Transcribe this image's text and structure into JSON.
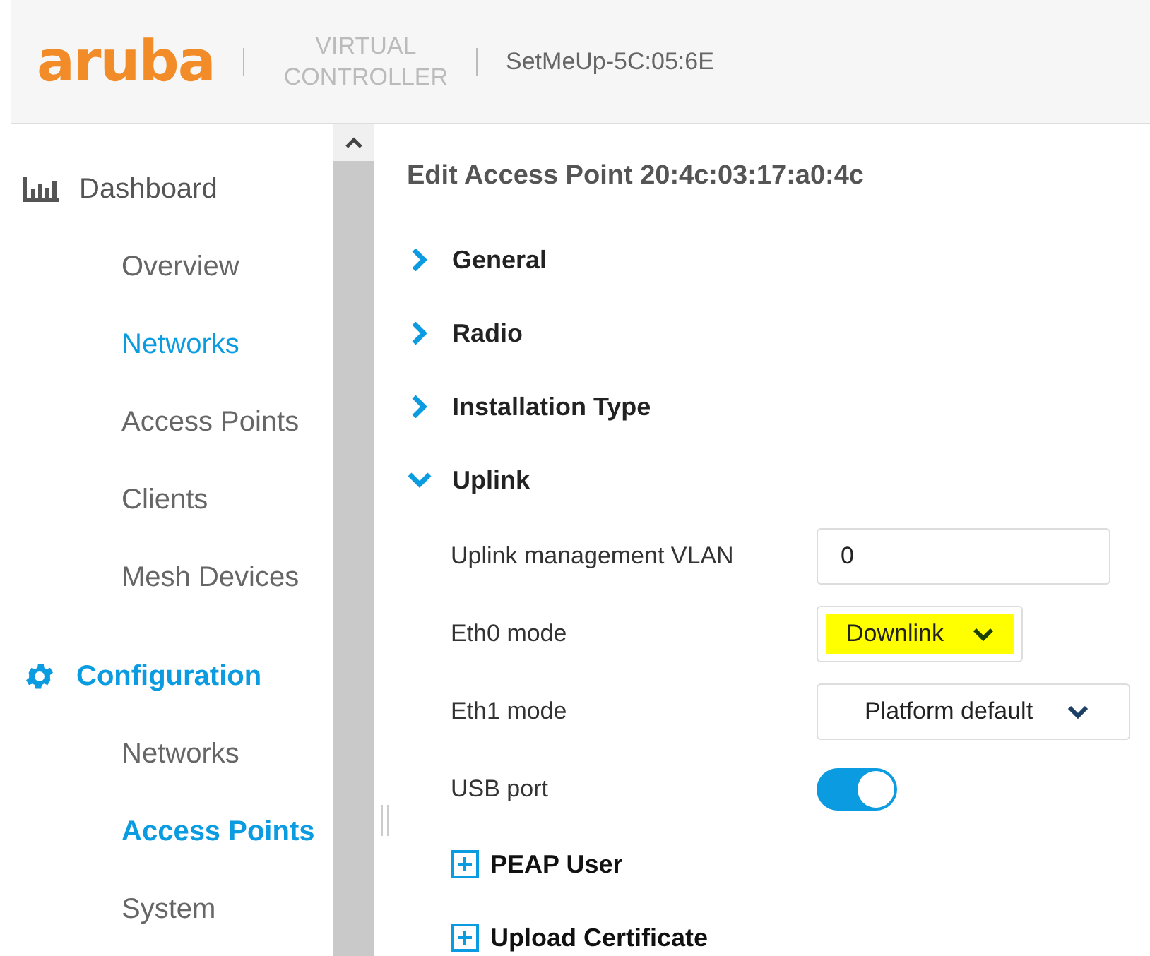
{
  "header": {
    "logo": "aruba",
    "product": [
      "VIRTUAL",
      "CONTROLLER"
    ],
    "device_name": "SetMeUp-5C:05:6E"
  },
  "sidebar": {
    "sections": [
      {
        "label": "Dashboard",
        "kind": "dashboard",
        "active": false,
        "items": [
          {
            "label": "Overview",
            "selected": false,
            "hovered": false
          },
          {
            "label": "Networks",
            "selected": false,
            "hovered": true
          },
          {
            "label": "Access Points",
            "selected": false,
            "hovered": false
          },
          {
            "label": "Clients",
            "selected": false,
            "hovered": false
          },
          {
            "label": "Mesh Devices",
            "selected": false,
            "hovered": false
          }
        ]
      },
      {
        "label": "Configuration",
        "kind": "configuration",
        "active": true,
        "items": [
          {
            "label": "Networks",
            "selected": false,
            "hovered": false
          },
          {
            "label": "Access Points",
            "selected": true,
            "hovered": false
          },
          {
            "label": "System",
            "selected": false,
            "hovered": false
          }
        ]
      }
    ]
  },
  "main": {
    "title": "Edit Access Point 20:4c:03:17:a0:4c",
    "sections": [
      {
        "label": "General",
        "expanded": false
      },
      {
        "label": "Radio",
        "expanded": false
      },
      {
        "label": "Installation Type",
        "expanded": false
      },
      {
        "label": "Uplink",
        "expanded": true,
        "fields": [
          {
            "kind": "text",
            "label": "Uplink management VLAN",
            "value": "0"
          },
          {
            "kind": "select",
            "label": "Eth0 mode",
            "value": "Downlink",
            "highlighted": true
          },
          {
            "kind": "select",
            "label": "Eth1 mode",
            "value": "Platform default",
            "highlighted": false
          },
          {
            "kind": "toggle",
            "label": "USB port",
            "on": true
          }
        ],
        "subsections": [
          {
            "label": "PEAP User",
            "expanded": false
          },
          {
            "label": "Upload Certificate",
            "expanded": false
          }
        ]
      }
    ]
  }
}
